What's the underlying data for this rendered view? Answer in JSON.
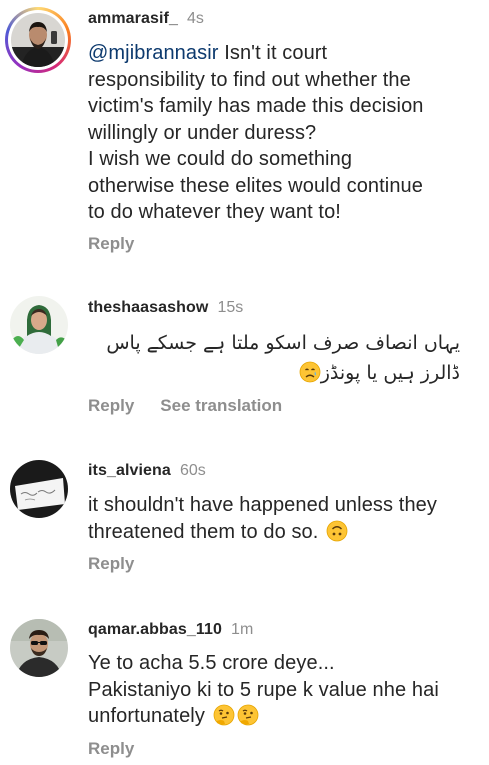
{
  "comments": [
    {
      "username": "ammarasif_",
      "time": "4s",
      "mention": "@mjibrannasir",
      "lines": [
        " Isn't it court",
        "responsibility to find out  whether the",
        "victim's family has made  this decision",
        "willingly or under duress?",
        "I wish we could do something",
        "otherwise these elites would continue",
        "to do whatever they want to!"
      ],
      "reply_label": "Reply"
    },
    {
      "username": "theshaasashow",
      "time": "15s",
      "lines": [
        "یہاں انصاف صرف اسکو ملتا ہے جسکے پاس",
        "ڈالرز ہیں یا پونڈز"
      ],
      "emoji": "crying-face-icon",
      "reply_label": "Reply",
      "translate_label": "See translation"
    },
    {
      "username": "its_alviena",
      "time": "60s",
      "lines": [
        "it shouldn't have happened unless they",
        "threatened them to do so."
      ],
      "emoji": "upside-down-face-icon",
      "reply_label": "Reply"
    },
    {
      "username": "qamar.abbas_110",
      "time": "1m",
      "lines": [
        "Ye to acha 5.5 crore deye...",
        "Pakistaniyo ki to 5 rupe k value nhe hai",
        "unfortunately"
      ],
      "emoji": "thinking-face-icon",
      "reply_label": "Reply"
    }
  ],
  "colors": {
    "text": "#262626",
    "meta": "#8e8e8e",
    "mention": "#0d3a6e",
    "emoji_yellow": "#fdc434"
  }
}
